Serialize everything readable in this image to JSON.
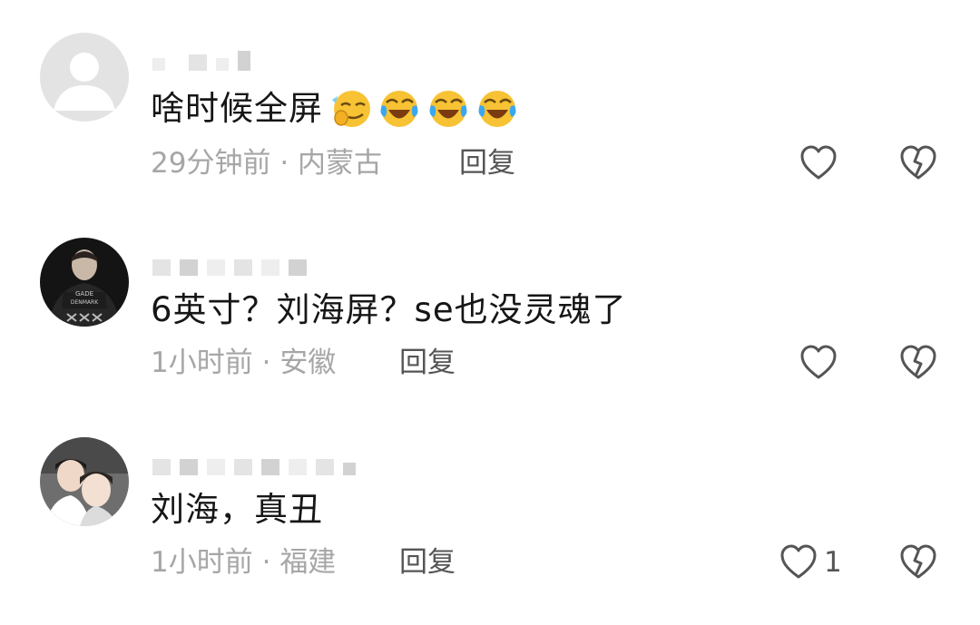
{
  "comments": [
    {
      "avatar": "default-avatar",
      "text": "啥时候全屏",
      "emojis": [
        "smirk-emoji",
        "laughing-crying-emoji",
        "laughing-crying-emoji",
        "laughing-crying-emoji"
      ],
      "time": "29分钟前",
      "separator": "·",
      "location": "内蒙古",
      "reply_label": "回复",
      "like_count": ""
    },
    {
      "avatar": "photo-avatar-dark-jacket",
      "text": "6英寸？刘海屏？se也没灵魂了",
      "emojis": [],
      "time": "1小时前",
      "separator": "·",
      "location": "安徽",
      "reply_label": "回复",
      "like_count": ""
    },
    {
      "avatar": "photo-avatar-couple",
      "text": "刘海，真丑",
      "emojis": [],
      "time": "1小时前",
      "separator": "·",
      "location": "福建",
      "reply_label": "回复",
      "like_count": "1"
    }
  ],
  "icons": {
    "like": "heart-outline-icon",
    "dislike": "broken-heart-icon"
  },
  "colors": {
    "text": "#161616",
    "meta": "#a6a6a6",
    "reply": "#555555",
    "icon": "#555555"
  }
}
